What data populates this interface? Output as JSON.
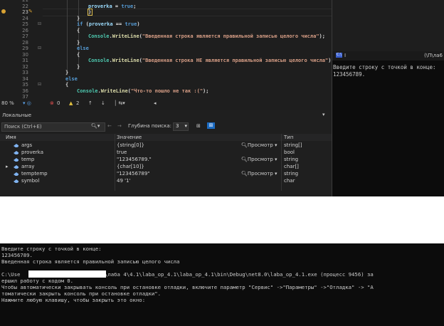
{
  "editor": {
    "lines": [
      {
        "n": "21",
        "fold": ""
      },
      {
        "n": "22",
        "fold": ""
      },
      {
        "n": "23",
        "fold": ""
      },
      {
        "n": "24",
        "fold": ""
      },
      {
        "n": "25",
        "fold": "⊟"
      },
      {
        "n": "26",
        "fold": ""
      },
      {
        "n": "27",
        "fold": ""
      },
      {
        "n": "28",
        "fold": ""
      },
      {
        "n": "29",
        "fold": "⊟"
      },
      {
        "n": "30",
        "fold": ""
      },
      {
        "n": "31",
        "fold": ""
      },
      {
        "n": "32",
        "fold": ""
      },
      {
        "n": "33",
        "fold": ""
      },
      {
        "n": "34",
        "fold": ""
      },
      {
        "n": "35",
        "fold": "⊟"
      },
      {
        "n": "36",
        "fold": ""
      },
      {
        "n": "37",
        "fold": ""
      }
    ],
    "code": {
      "l22_var": "proverka",
      "l22_rest": " = ",
      "l22_val": "true",
      "l22_end": ";",
      "l23": "}",
      "l24": "}",
      "l25_kw": "if",
      "l25_a": " (",
      "l25_var": "proverka",
      "l25_b": " == ",
      "l25_val": "true",
      "l25_c": ")",
      "l26": "{",
      "l27_type": "Console",
      "l27_dot": ".",
      "l27_method": "WriteLine",
      "l27_open": "(",
      "l27_str": "\"Введенная строка является правильной записью целого числа\"",
      "l27_close": ");",
      "l28": "}",
      "l29": "else",
      "l30": "{",
      "l31_type": "Console",
      "l31_dot": ".",
      "l31_method": "WriteLine",
      "l31_open": "(",
      "l31_str": "\"Введенная строка НЕ является правильной записью целого числа\"",
      "l31_close": ");",
      "l32": "}",
      "l33": "}",
      "l34": "else",
      "l35": "{",
      "l36_type": "Console",
      "l36_dot": ".",
      "l36_method": "WriteLine",
      "l36_open": "(",
      "l36_str": "\"Что-то пошло не так :(\"",
      "l36_close": ");"
    },
    "status": {
      "zoom": "80 %",
      "errors": "0",
      "warnings": "2",
      "up_arrow": "↑",
      "down_arrow": "↓"
    }
  },
  "locals": {
    "title": "Локальные",
    "search_placeholder": "Поиск (Ctrl+E)",
    "depth_label": "Глубина поиска:",
    "depth_value": "3",
    "columns": {
      "name": "Имя",
      "value": "Значение",
      "type": "Тип"
    },
    "view_label": "Просмотр",
    "rows": [
      {
        "name": "args",
        "value": "{string[0]}",
        "type": "string[]",
        "preview": "Просмотр"
      },
      {
        "name": "proverka",
        "value": "true",
        "type": "bool",
        "preview": ""
      },
      {
        "name": "temp",
        "value": "\"123456789.\"",
        "type": "string",
        "preview": "Просмотр"
      },
      {
        "name": "array",
        "value": "{char[10]}",
        "type": "char[]",
        "preview": ""
      },
      {
        "name": "temptemp",
        "value": "\"123456789\"",
        "type": "string",
        "preview": "Просмотр"
      },
      {
        "name": "symbol",
        "value": "49 '1'",
        "type": "char",
        "preview": ""
      }
    ]
  },
  "mini_console": {
    "title_left": "I",
    "title_right": "(\\П\\ла6",
    "lines": [
      "Введите строку с точкой в конце:",
      "123456789."
    ]
  },
  "console": {
    "lines": [
      "Введите строку с точкой в конце:",
      "123456789.",
      "Введенная строка является правильной записью целого числа",
      "",
      "C:\\Use                      !!\\ОП\\лаба 4\\4.1\\laba_op_4.1\\laba_op_4.1\\bin\\Debug\\net8.0\\laba_op_4.1.exe (процесс 9456) за",
      "ершил работу с кодом 0.",
      "Чтобы автоматически закрывать консоль при остановке отладки, включите параметр \"Сервис\" ->\"Параметры\" ->\"Отладка\" -> \"А",
      "томатически закрыть консоль при остановке отладки\".",
      "Нажмите любую клавишу, чтобы закрыть это окно:"
    ]
  },
  "colors": {
    "editor_bg": "#1e1e1e",
    "console_bg": "#0c0c0c",
    "keyword": "#569cd6",
    "type": "#4ec9b0",
    "method": "#dcdcaa",
    "string": "#d69d85",
    "variable": "#9cdcfe",
    "breakpoint": "#d9a233",
    "selection": "#094771"
  }
}
